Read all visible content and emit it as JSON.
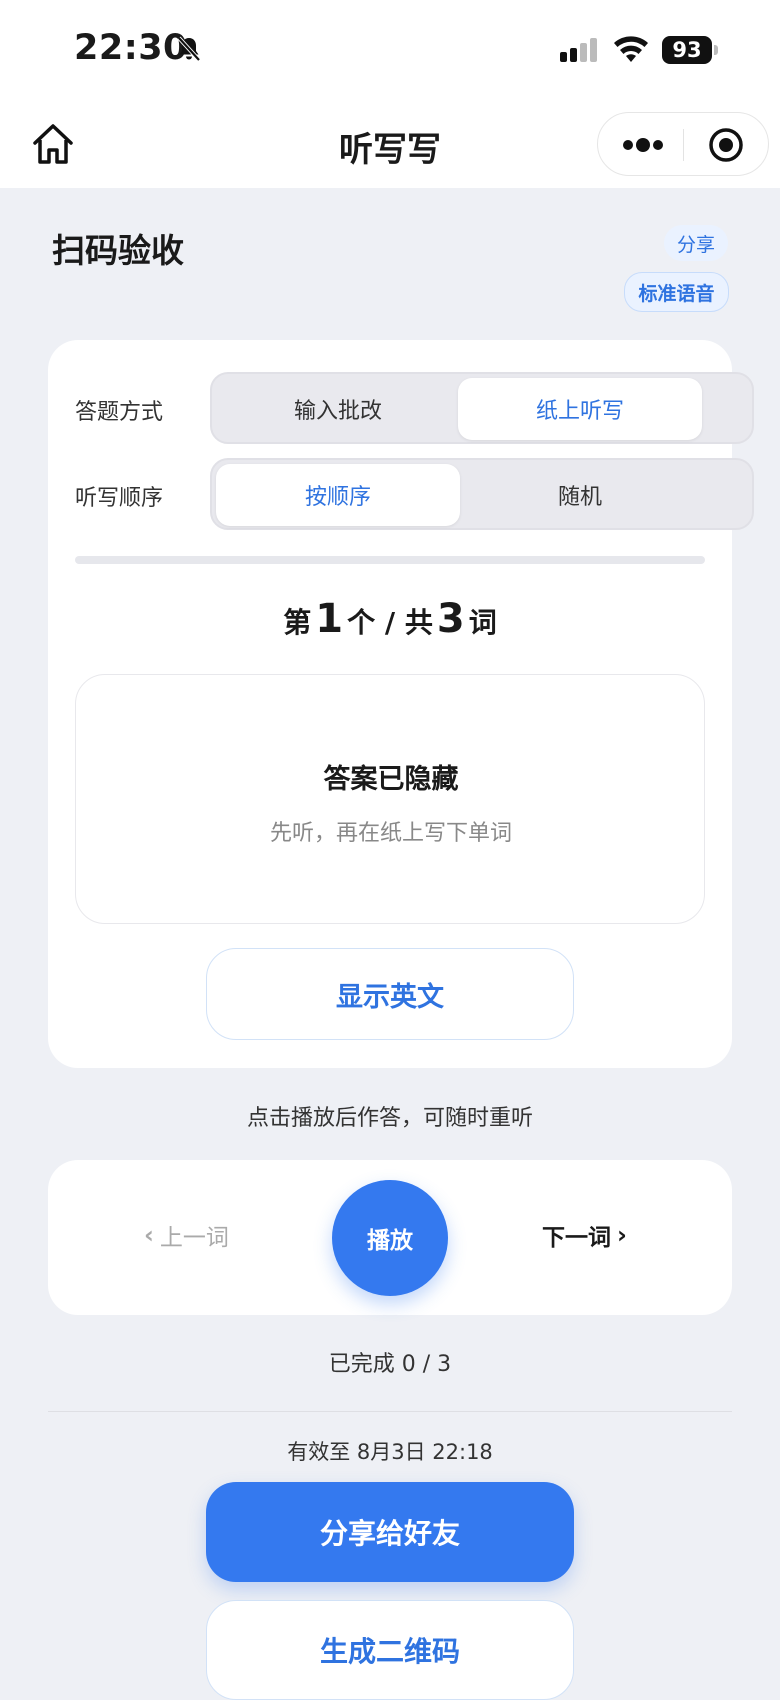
{
  "status_bar": {
    "time": "22:30",
    "battery": "93"
  },
  "nav": {
    "title": "听写写"
  },
  "header": {
    "title": "扫码验收",
    "share_label": "分享",
    "voice_label": "标准语音"
  },
  "settings": {
    "answer_mode": {
      "label": "答题方式",
      "options": [
        "输入批改",
        "纸上听写"
      ],
      "selected": "纸上听写"
    },
    "order_mode": {
      "label": "听写顺序",
      "options": [
        "按顺序",
        "随机"
      ],
      "selected": "按顺序"
    }
  },
  "progress": {
    "current": "1",
    "total": "3",
    "fraction": 0.0
  },
  "counter": {
    "prefix": "第",
    "mid": "个 / 共",
    "suffix": "词"
  },
  "answer": {
    "title": "答案已隐藏",
    "hint": "先听，再在纸上写下单词",
    "show_label": "显示英文"
  },
  "tip": "点击播放后作答，可随时重听",
  "player": {
    "prev_label": "上一词",
    "play_label": "播放",
    "next_label": "下一词"
  },
  "completed": "已完成 0 / 3",
  "expiry": "有效至 8月3日 22:18",
  "actions": {
    "share_friend": "分享给好友",
    "qr_code": "生成二维码"
  },
  "colors": {
    "accent": "#3479ef",
    "accent_text": "#2f73e0",
    "background": "#eef0f5"
  }
}
